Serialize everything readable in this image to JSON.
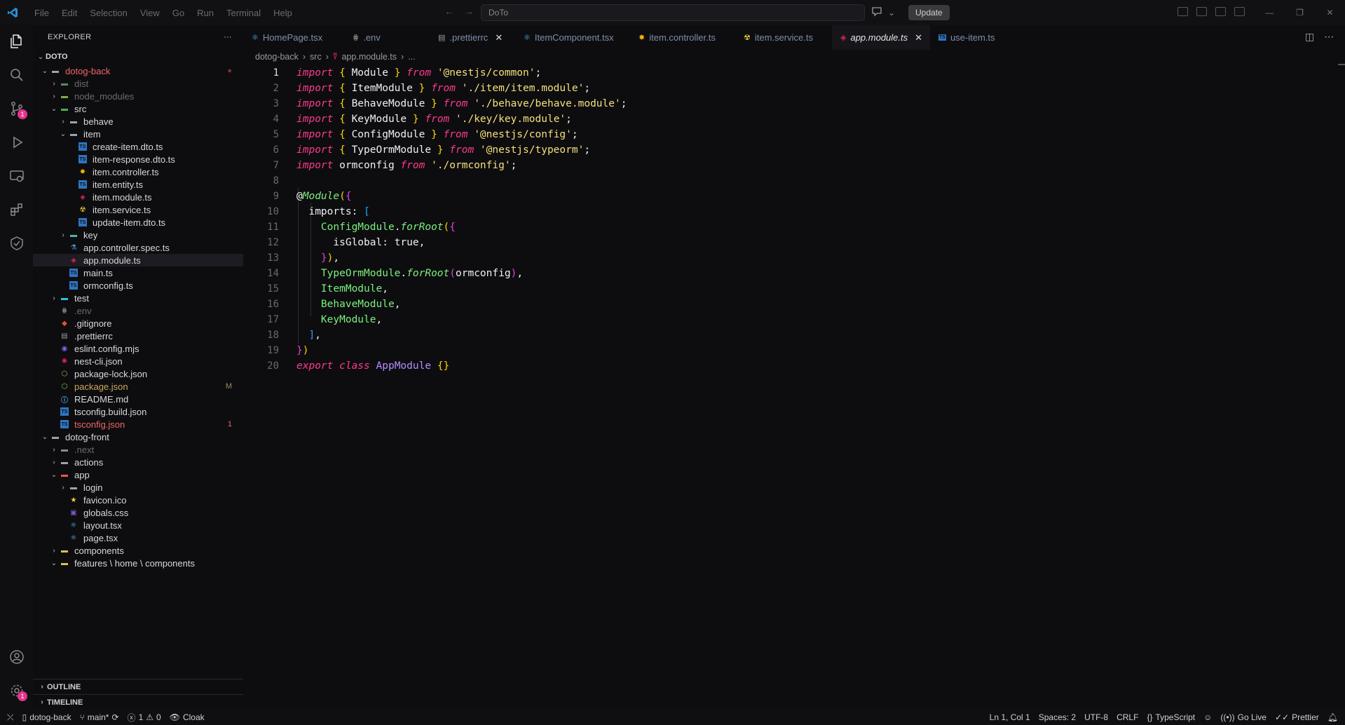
{
  "menu": [
    "File",
    "Edit",
    "Selection",
    "View",
    "Go",
    "Run",
    "Terminal",
    "Help"
  ],
  "command_center": "DoTo",
  "update_label": "Update",
  "explorer": {
    "title": "EXPLORER",
    "root": "DOTO",
    "rows": [
      {
        "label": "dotog-back",
        "indent": 0,
        "type": "folder-open",
        "color": "#f06565",
        "deco": "●",
        "decoColor": "#8a2a2a",
        "icon": "folder"
      },
      {
        "label": "dist",
        "indent": 1,
        "type": "folder-closed",
        "color": "#6b6b6b",
        "icon": "folder-dist"
      },
      {
        "label": "node_modules",
        "indent": 1,
        "type": "folder-closed",
        "color": "#6b6b6b",
        "icon": "folder-node"
      },
      {
        "label": "src",
        "indent": 1,
        "type": "folder-open",
        "color": "#d8d8d8",
        "icon": "folder-src"
      },
      {
        "label": "behave",
        "indent": 2,
        "type": "folder-closed",
        "color": "#d8d8d8",
        "icon": "folder"
      },
      {
        "label": "item",
        "indent": 2,
        "type": "folder-open",
        "color": "#d8d8d8",
        "icon": "folder"
      },
      {
        "label": "create-item.dto.ts",
        "indent": 3,
        "type": "file",
        "color": "#d8d8d8",
        "icon": "ts"
      },
      {
        "label": "item-response.dto.ts",
        "indent": 3,
        "type": "file",
        "color": "#d8d8d8",
        "icon": "ts"
      },
      {
        "label": "item.controller.ts",
        "indent": 3,
        "type": "file",
        "color": "#d8d8d8",
        "icon": "gear"
      },
      {
        "label": "item.entity.ts",
        "indent": 3,
        "type": "file",
        "color": "#d8d8d8",
        "icon": "ts"
      },
      {
        "label": "item.module.ts",
        "indent": 3,
        "type": "file",
        "color": "#d8d8d8",
        "icon": "nest"
      },
      {
        "label": "item.service.ts",
        "indent": 3,
        "type": "file",
        "color": "#d8d8d8",
        "icon": "service"
      },
      {
        "label": "update-item.dto.ts",
        "indent": 3,
        "type": "file",
        "color": "#d8d8d8",
        "icon": "ts"
      },
      {
        "label": "key",
        "indent": 2,
        "type": "folder-closed",
        "color": "#d8d8d8",
        "icon": "folder-key"
      },
      {
        "label": "app.controller.spec.ts",
        "indent": 2,
        "type": "file",
        "color": "#d8d8d8",
        "icon": "test"
      },
      {
        "label": "app.module.ts",
        "indent": 2,
        "type": "file",
        "color": "#d8d8d8",
        "icon": "nest",
        "active": true
      },
      {
        "label": "main.ts",
        "indent": 2,
        "type": "file",
        "color": "#d8d8d8",
        "icon": "ts"
      },
      {
        "label": "ormconfig.ts",
        "indent": 2,
        "type": "file",
        "color": "#d8d8d8",
        "icon": "ts"
      },
      {
        "label": "test",
        "indent": 1,
        "type": "folder-closed",
        "color": "#d8d8d8",
        "icon": "folder-test"
      },
      {
        "label": ".env",
        "indent": 1,
        "type": "file",
        "color": "#6b6b6b",
        "icon": "env"
      },
      {
        "label": ".gitignore",
        "indent": 1,
        "type": "file",
        "color": "#d8d8d8",
        "icon": "git"
      },
      {
        "label": ".prettierrc",
        "indent": 1,
        "type": "file",
        "color": "#d8d8d8",
        "icon": "prettier"
      },
      {
        "label": "eslint.config.mjs",
        "indent": 1,
        "type": "file",
        "color": "#d8d8d8",
        "icon": "eslint"
      },
      {
        "label": "nest-cli.json",
        "indent": 1,
        "type": "file",
        "color": "#d8d8d8",
        "icon": "nestcli"
      },
      {
        "label": "package-lock.json",
        "indent": 1,
        "type": "file",
        "color": "#d8d8d8",
        "icon": "npm"
      },
      {
        "label": "package.json",
        "indent": 1,
        "type": "file",
        "color": "#c9a75a",
        "icon": "npm",
        "deco": "M",
        "decoColor": "#9a8a60"
      },
      {
        "label": "README.md",
        "indent": 1,
        "type": "file",
        "color": "#d8d8d8",
        "icon": "info"
      },
      {
        "label": "tsconfig.build.json",
        "indent": 1,
        "type": "file",
        "color": "#d8d8d8",
        "icon": "tsconfig"
      },
      {
        "label": "tsconfig.json",
        "indent": 1,
        "type": "file",
        "color": "#f06565",
        "icon": "tsconfig",
        "deco": "1",
        "decoColor": "#f06565"
      },
      {
        "label": "dotog-front",
        "indent": 0,
        "type": "folder-open",
        "color": "#d8d8d8",
        "icon": "folder"
      },
      {
        "label": ".next",
        "indent": 1,
        "type": "folder-closed",
        "color": "#6b6b6b",
        "icon": "folder-next"
      },
      {
        "label": "actions",
        "indent": 1,
        "type": "folder-closed",
        "color": "#d8d8d8",
        "icon": "folder"
      },
      {
        "label": "app",
        "indent": 1,
        "type": "folder-open",
        "color": "#d8d8d8",
        "icon": "folder-app"
      },
      {
        "label": "login",
        "indent": 2,
        "type": "folder-closed",
        "color": "#d8d8d8",
        "icon": "folder"
      },
      {
        "label": "favicon.ico",
        "indent": 2,
        "type": "file",
        "color": "#d8d8d8",
        "icon": "star"
      },
      {
        "label": "globals.css",
        "indent": 2,
        "type": "file",
        "color": "#d8d8d8",
        "icon": "css"
      },
      {
        "label": "layout.tsx",
        "indent": 2,
        "type": "file",
        "color": "#d8d8d8",
        "icon": "react"
      },
      {
        "label": "page.tsx",
        "indent": 2,
        "type": "file",
        "color": "#d8d8d8",
        "icon": "react"
      },
      {
        "label": "components",
        "indent": 1,
        "type": "folder-closed",
        "color": "#d8d8d8",
        "icon": "folder-comp"
      },
      {
        "label": "features \\ home \\ components",
        "indent": 1,
        "type": "folder-open",
        "color": "#d8d8d8",
        "icon": "folder-comp"
      }
    ],
    "outline": "OUTLINE",
    "timeline": "TIMELINE"
  },
  "tabs": [
    {
      "label": "HomePage.tsx",
      "icon": "react",
      "active": false
    },
    {
      "label": ".env",
      "icon": "env",
      "active": false
    },
    {
      "label": ".prettierrc",
      "icon": "prettier",
      "active": false,
      "close": true
    },
    {
      "label": "ItemComponent.tsx",
      "icon": "react",
      "active": false
    },
    {
      "label": "item.controller.ts",
      "icon": "gear",
      "active": false
    },
    {
      "label": "item.service.ts",
      "icon": "service",
      "active": false
    },
    {
      "label": "app.module.ts",
      "icon": "nest",
      "active": true,
      "close": true
    },
    {
      "label": "use-item.ts",
      "icon": "ts",
      "active": false
    }
  ],
  "breadcrumb": [
    "dotog-back",
    "src",
    "app.module.ts",
    "..."
  ],
  "code": {
    "current_line": 1,
    "lines": [
      [
        [
          "kw",
          "import "
        ],
        [
          "br",
          "{ "
        ],
        [
          "id",
          "Module "
        ],
        [
          "br",
          "} "
        ],
        [
          "kw",
          "from "
        ],
        [
          "str",
          "'@nestjs/common'"
        ],
        [
          "pun",
          ";"
        ]
      ],
      [
        [
          "kw",
          "import "
        ],
        [
          "br",
          "{ "
        ],
        [
          "id",
          "ItemModule "
        ],
        [
          "br",
          "} "
        ],
        [
          "kw",
          "from "
        ],
        [
          "str",
          "'./item/item.module'"
        ],
        [
          "pun",
          ";"
        ]
      ],
      [
        [
          "kw",
          "import "
        ],
        [
          "br",
          "{ "
        ],
        [
          "id",
          "BehaveModule "
        ],
        [
          "br",
          "} "
        ],
        [
          "kw",
          "from "
        ],
        [
          "str",
          "'./behave/behave.module'"
        ],
        [
          "pun",
          ";"
        ]
      ],
      [
        [
          "kw",
          "import "
        ],
        [
          "br",
          "{ "
        ],
        [
          "id",
          "KeyModule "
        ],
        [
          "br",
          "} "
        ],
        [
          "kw",
          "from "
        ],
        [
          "str",
          "'./key/key.module'"
        ],
        [
          "pun",
          ";"
        ]
      ],
      [
        [
          "kw",
          "import "
        ],
        [
          "br",
          "{ "
        ],
        [
          "id",
          "ConfigModule "
        ],
        [
          "br",
          "} "
        ],
        [
          "kw",
          "from "
        ],
        [
          "str",
          "'@nestjs/config'"
        ],
        [
          "pun",
          ";"
        ]
      ],
      [
        [
          "kw",
          "import "
        ],
        [
          "br",
          "{ "
        ],
        [
          "id",
          "TypeOrmModule "
        ],
        [
          "br",
          "} "
        ],
        [
          "kw",
          "from "
        ],
        [
          "str",
          "'@nestjs/typeorm'"
        ],
        [
          "pun",
          ";"
        ]
      ],
      [
        [
          "kw",
          "import "
        ],
        [
          "id",
          "ormconfig "
        ],
        [
          "kw",
          "from "
        ],
        [
          "str",
          "'./ormconfig'"
        ],
        [
          "pun",
          ";"
        ]
      ],
      [],
      [
        [
          "pun",
          "@"
        ],
        [
          "dec",
          "Module"
        ],
        [
          "br",
          "("
        ],
        [
          "br2",
          "{"
        ]
      ],
      [
        [
          "pun",
          "  "
        ],
        [
          "prop",
          "imports"
        ],
        [
          "pun",
          ": "
        ],
        [
          "br3",
          "["
        ]
      ],
      [
        [
          "pun",
          "    "
        ],
        [
          "cls",
          "ConfigModule"
        ],
        [
          "pun",
          "."
        ],
        [
          "fn",
          "forRoot"
        ],
        [
          "br",
          "("
        ],
        [
          "br2",
          "{"
        ]
      ],
      [
        [
          "pun",
          "      "
        ],
        [
          "prop",
          "isGlobal"
        ],
        [
          "pun",
          ": "
        ],
        [
          "bool",
          "true"
        ],
        [
          "pun",
          ","
        ]
      ],
      [
        [
          "pun",
          "    "
        ],
        [
          "br2",
          "}"
        ],
        [
          "br",
          ")"
        ],
        [
          "pun",
          ","
        ]
      ],
      [
        [
          "pun",
          "    "
        ],
        [
          "cls",
          "TypeOrmModule"
        ],
        [
          "pun",
          "."
        ],
        [
          "fn",
          "forRoot"
        ],
        [
          "br2",
          "("
        ],
        [
          "id",
          "ormconfig"
        ],
        [
          "br2",
          ")"
        ],
        [
          "pun",
          ","
        ]
      ],
      [
        [
          "pun",
          "    "
        ],
        [
          "cls",
          "ItemModule"
        ],
        [
          "pun",
          ","
        ]
      ],
      [
        [
          "pun",
          "    "
        ],
        [
          "cls",
          "BehaveModule"
        ],
        [
          "pun",
          ","
        ]
      ],
      [
        [
          "pun",
          "    "
        ],
        [
          "cls",
          "KeyModule"
        ],
        [
          "pun",
          ","
        ]
      ],
      [
        [
          "pun",
          "  "
        ],
        [
          "br3",
          "]"
        ],
        [
          "pun",
          ","
        ]
      ],
      [
        [
          "br2",
          "}"
        ],
        [
          "br",
          ")"
        ]
      ],
      [
        [
          "kw",
          "export "
        ],
        [
          "kw",
          "class "
        ],
        [
          "ty",
          "AppModule "
        ],
        [
          "br",
          "{}"
        ]
      ]
    ]
  },
  "status": {
    "remote": "dotog-back",
    "branch": "main*",
    "errors": "1",
    "warnings": "0",
    "cloak": "Cloak",
    "position": "Ln 1, Col 1",
    "spaces": "Spaces: 2",
    "encoding": "UTF-8",
    "eol": "CRLF",
    "language": "TypeScript",
    "golive": "Go Live",
    "prettier": "Prettier"
  }
}
